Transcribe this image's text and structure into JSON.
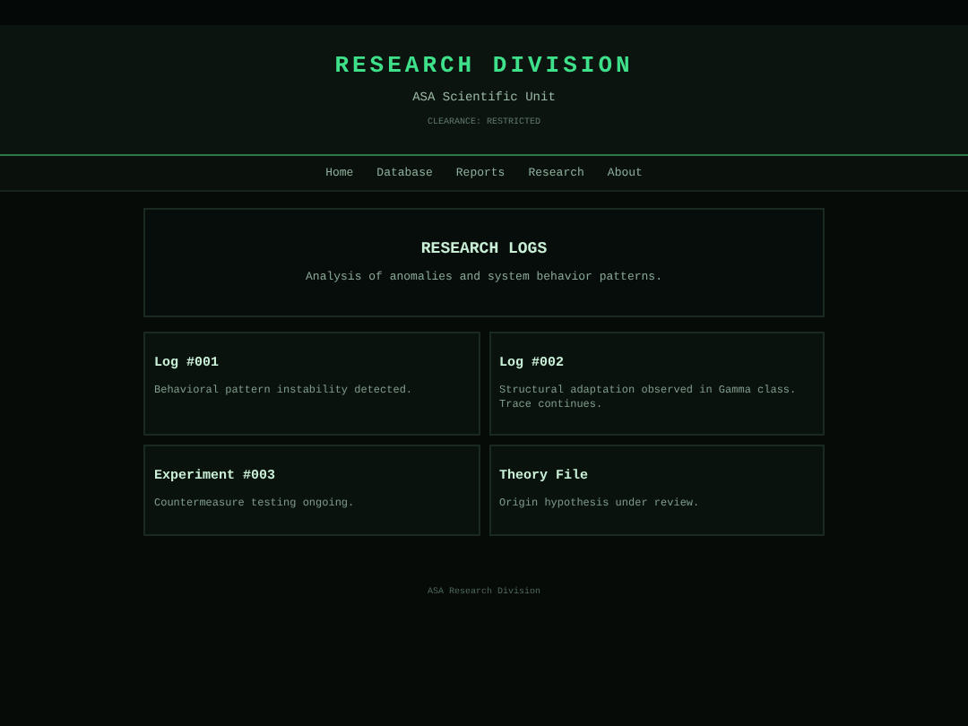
{
  "header": {
    "title": "RESEARCH DIVISION",
    "subtitle": "ASA Scientific Unit",
    "clearance": "CLEARANCE: RESTRICTED"
  },
  "nav": [
    "Home",
    "Database",
    "Reports",
    "Research",
    "About"
  ],
  "intro": {
    "title": "RESEARCH LOGS",
    "text": "Analysis of anomalies and system behavior patterns."
  },
  "cards": [
    {
      "title": "Log #001",
      "text": "Behavioral pattern instability detected."
    },
    {
      "title": "Log #002",
      "text": "Structural adaptation observed in Gamma class. Trace continues."
    },
    {
      "title": "Experiment #003",
      "text": "Countermeasure testing ongoing."
    },
    {
      "title": "Theory File",
      "text": "Origin hypothesis under review."
    }
  ],
  "footer": "ASA Research Division"
}
